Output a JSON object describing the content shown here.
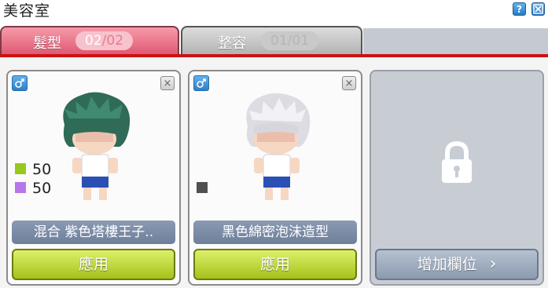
{
  "window": {
    "title": "美容室",
    "help_glyph": "?",
    "close_glyph": "✕"
  },
  "tabs": [
    {
      "label": "髮型",
      "current": "02",
      "separator": "/",
      "total": "02",
      "active": true
    },
    {
      "label": "整容",
      "current": "01",
      "separator": "/",
      "total": "01",
      "active": false
    }
  ],
  "cards": [
    {
      "gender_icon": "male-icon",
      "close_glyph": "×",
      "hair_color": "#2f6b57",
      "mix": [
        {
          "color": "#98c81e",
          "value": "50"
        },
        {
          "color": "#b678e8",
          "value": "50"
        }
      ],
      "name": "混合 紫色塔樓王子..",
      "apply_label": "應用"
    },
    {
      "gender_icon": "male-icon",
      "close_glyph": "×",
      "hair_color": "#e6e6ea",
      "mix": [
        {
          "color": "#505050",
          "value": ""
        }
      ],
      "name": "黑色綿密泡沫造型",
      "apply_label": "應用"
    },
    {
      "locked": true,
      "lock_icon": "lock-icon",
      "add_label": "增加欄位",
      "arrow": "›"
    }
  ],
  "colors": {
    "accent_red": "#cc1111",
    "tab_active": "#e05a74",
    "apply_green": "#a5c21a"
  }
}
